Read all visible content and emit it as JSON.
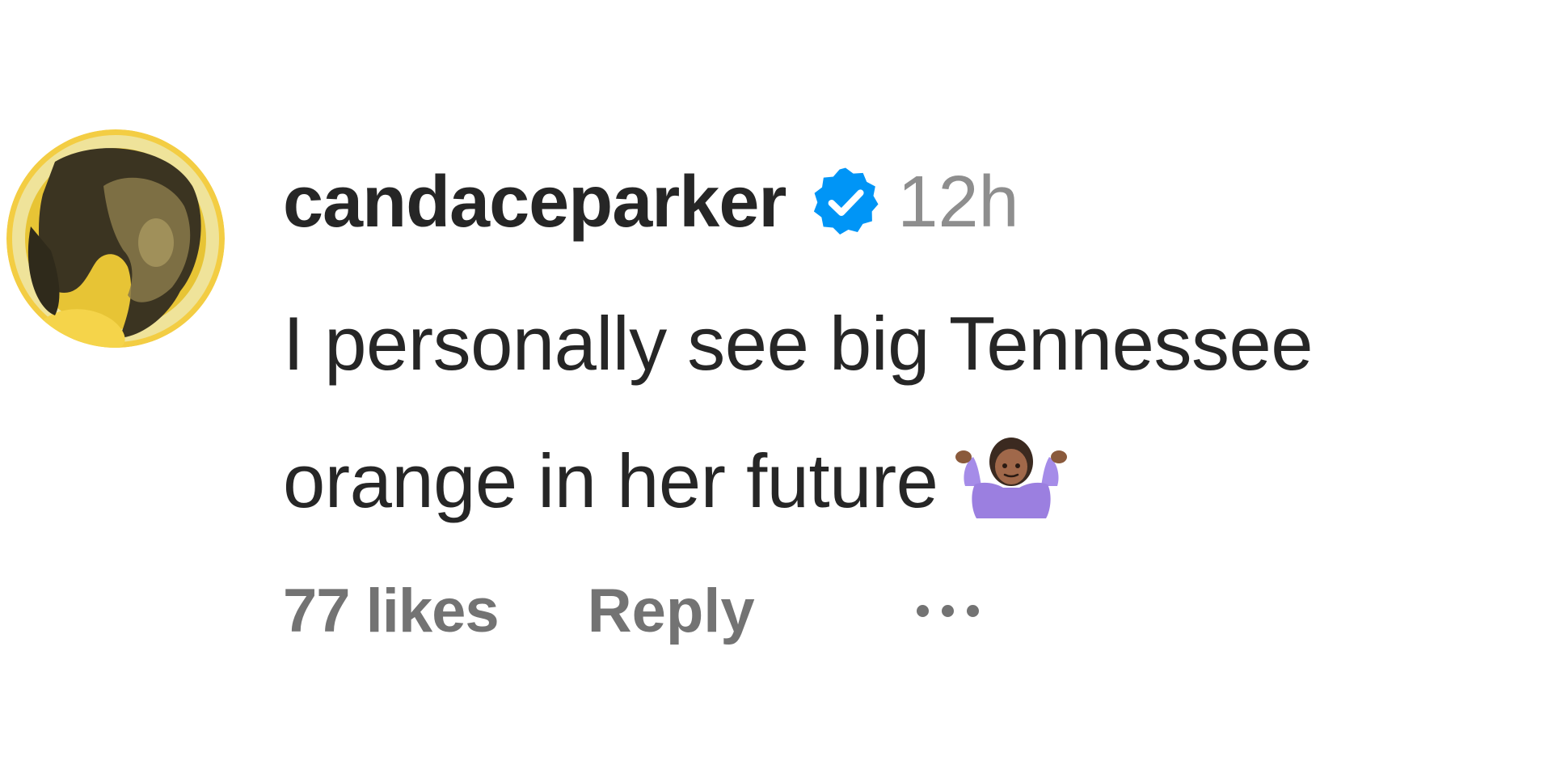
{
  "comment": {
    "username": "candaceparker",
    "verified_icon": "verified-badge-icon",
    "timestamp": "12h",
    "text_lines": [
      "I personally see big Tennessee",
      "orange in her future"
    ],
    "emoji": "person-shrugging-icon",
    "likes": "77 likes",
    "reply_label": "Reply",
    "more_icon": "more-options-icon"
  },
  "colors": {
    "username": "#262626",
    "secondary": "#8e8e8e",
    "action": "#737373",
    "verified_blue": "#0095f6",
    "avatar_bg": "#f0c73a"
  }
}
